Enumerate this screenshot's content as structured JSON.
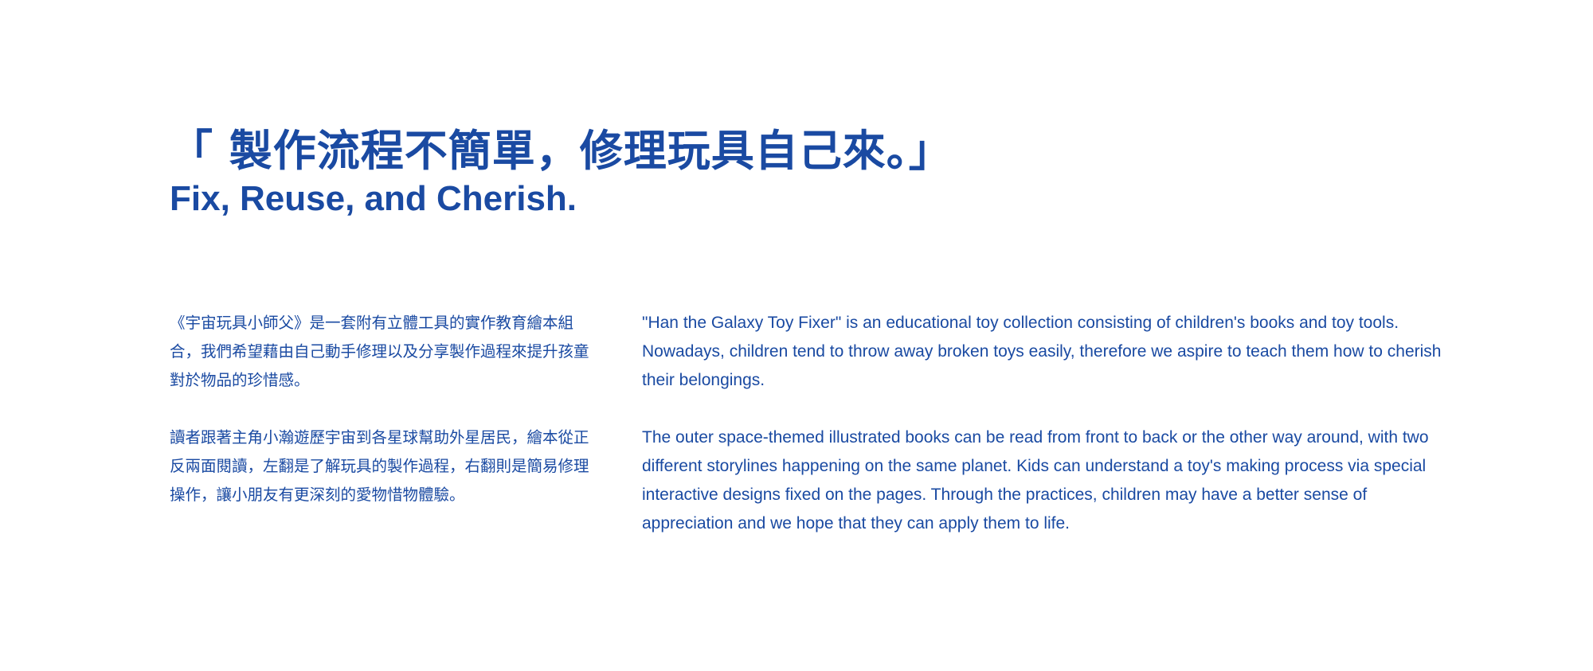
{
  "heading": {
    "title_zh": "「 製作流程不簡單，修理玩具自己來。」",
    "title_en": "Fix, Reuse, and Cherish."
  },
  "zh_paragraphs": [
    "《宇宙玩具小師父》是一套附有立體工具的實作教育繪本組合，我們希望藉由自己動手修理以及分享製作過程來提升孩童對於物品的珍惜感。",
    "讀者跟著主角小瀚遊歷宇宙到各星球幫助外星居民，繪本從正反兩面閱讀，左翻是了解玩具的製作過程，右翻則是簡易修理操作，讓小朋友有更深刻的愛物惜物體驗。"
  ],
  "en_paragraphs": [
    "\"Han the Galaxy Toy Fixer\" is an educational toy collection consisting of children's books and toy tools. Nowadays, children tend to throw away broken toys easily, therefore we aspire to teach them how to cherish their belongings.",
    "The outer space-themed illustrated books can be read from front to back or the other way around, with two different storylines happening on the same planet. Kids can understand a toy's making process via special interactive designs fixed on the pages. Through the practices, children may have a better sense of appreciation and we hope that they can apply them to life."
  ],
  "colors": {
    "text": "#1a4aa2",
    "background": "#ffffff"
  }
}
